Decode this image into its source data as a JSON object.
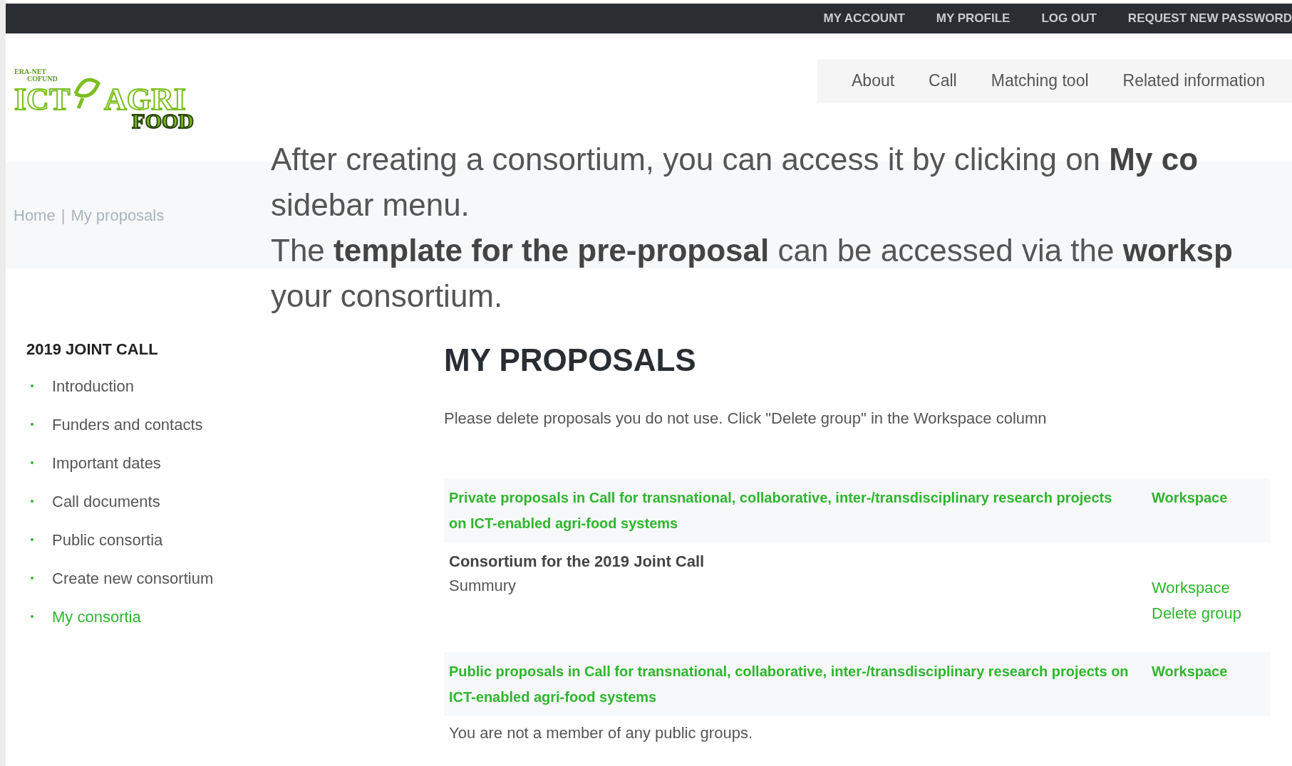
{
  "top_links": [
    "MY ACCOUNT",
    "MY PROFILE",
    "LOG OUT",
    "REQUEST NEW PASSWORD"
  ],
  "logo": {
    "top": "ERA-NET",
    "sub": "COFUND",
    "left": "ICT",
    "right": "AGRI",
    "bottom": "FOOD"
  },
  "nav": [
    "About",
    "Call",
    "Matching tool",
    "Related information"
  ],
  "breadcrumb": {
    "items": [
      "Home",
      "My proposals"
    ],
    "separator": "|"
  },
  "annotation": [
    "After creating a consortium, you can access it by clicking on **My co**",
    "sidebar menu.",
    "The **template for the pre-proposal** can be accessed via the **worksp**",
    "your consortium."
  ],
  "sidebar": {
    "heading": "2019 JOINT CALL",
    "items": [
      {
        "label": "Introduction",
        "selected": false
      },
      {
        "label": "Funders and contacts",
        "selected": false
      },
      {
        "label": "Important dates",
        "selected": false
      },
      {
        "label": "Call documents",
        "selected": false
      },
      {
        "label": "Public consortia",
        "selected": false
      },
      {
        "label": "Create new consortium",
        "selected": false
      },
      {
        "label": "My consortia",
        "selected": true
      }
    ]
  },
  "main": {
    "title": "MY PROPOSALS",
    "note": "Please delete proposals you do not use. Click \"Delete group\" in the Workspace column",
    "rows": [
      {
        "kind": "header",
        "title": "Private proposals in Call for transnational, collaborative, inter-/transdisciplinary research projects on ICT-enabled agri-food systems",
        "links": [
          "Workspace"
        ]
      },
      {
        "kind": "item",
        "title": "Consortium for the 2019 Joint Call",
        "summary": "Summury",
        "links": [
          "Workspace",
          "Delete group"
        ]
      },
      {
        "kind": "header",
        "title": "Public proposals in Call for transnational, collaborative, inter-/transdisciplinary research projects on ICT-enabled agri-food systems",
        "links": [
          "Workspace"
        ]
      },
      {
        "kind": "message",
        "text": "You are not a member of any public groups."
      }
    ]
  }
}
